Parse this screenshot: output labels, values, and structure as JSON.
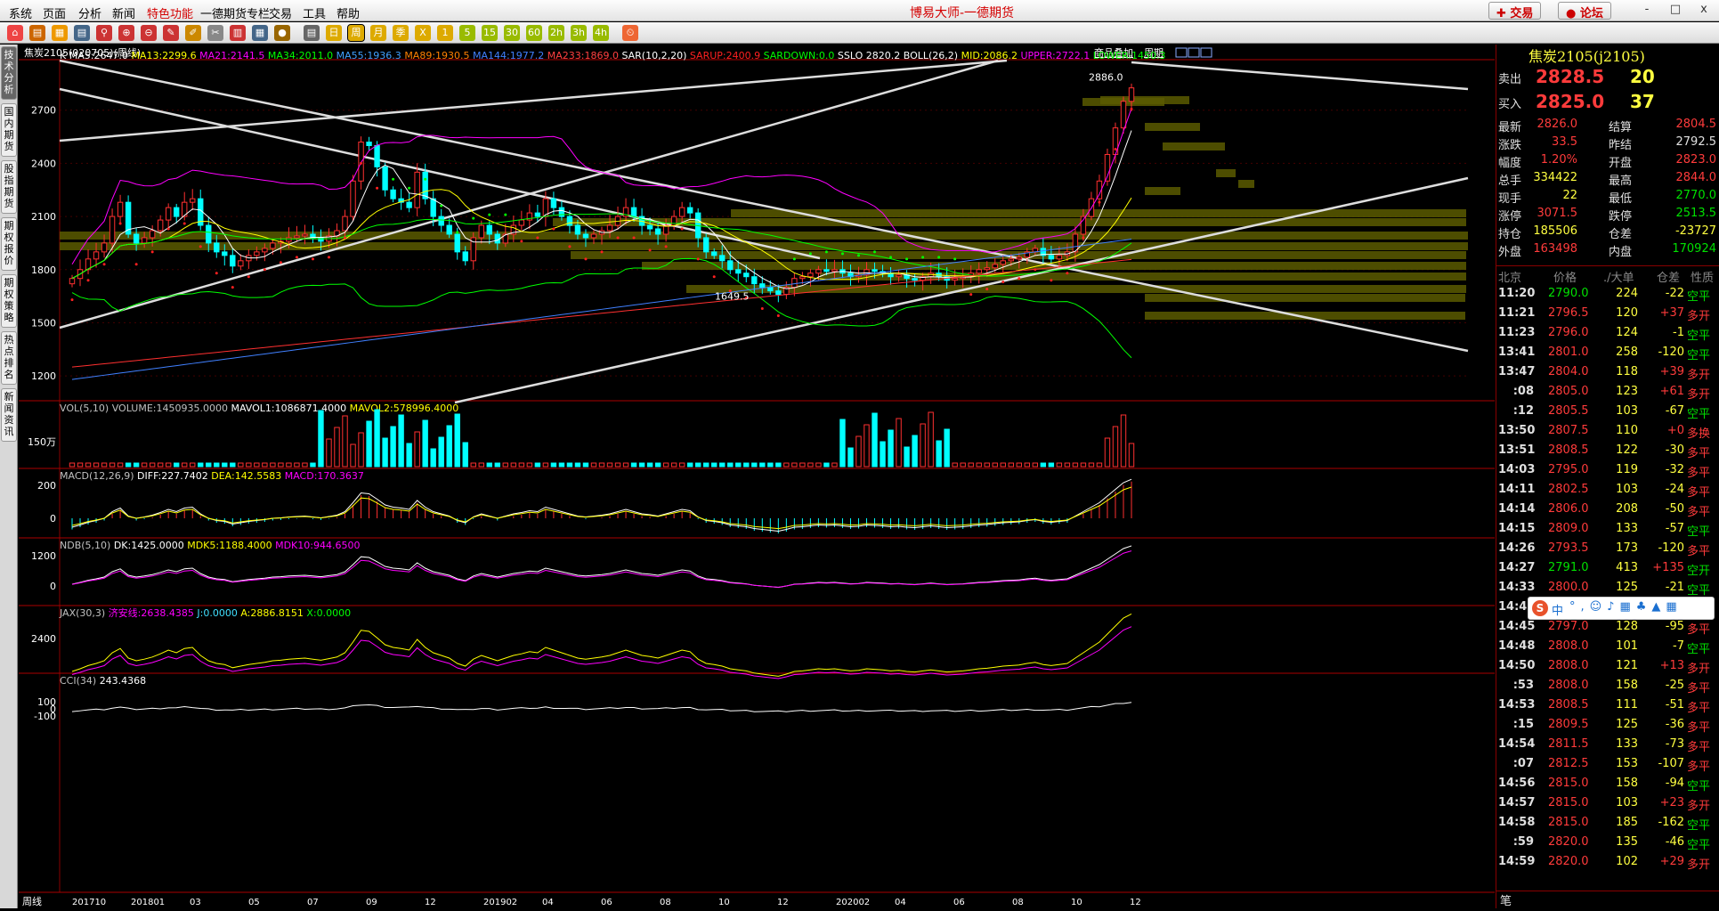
{
  "app_title": "博易大师-一德期货",
  "menu": [
    "系统",
    "页面",
    "分析",
    "新闻",
    "特色功能",
    "一德期货专栏",
    "交易",
    "工具",
    "帮助"
  ],
  "top_buttons": {
    "trade": "交易",
    "forum": "论坛"
  },
  "window_buttons": [
    "-",
    "□",
    "x"
  ],
  "toolbar_icons": [
    "home-icon",
    "folder-icon",
    "open-icon",
    "grid-icon",
    "search-icon",
    "zoom-in-icon",
    "zoom-out-icon",
    "draw-icon",
    "brush-icon",
    "cut-icon",
    "bar-icon",
    "calc-icon",
    "bullet-icon",
    "table-icon",
    "day-icon",
    "week-icon",
    "month-icon",
    "season-icon",
    "x-icon",
    "1-icon",
    "5-icon",
    "15-icon",
    "30-icon",
    "60-icon",
    "2h-icon",
    "3h-icon",
    "4h-icon",
    "clock-icon"
  ],
  "left_tabs": [
    "技术分析",
    "国内期货",
    "股指期货",
    "期权报价",
    "期权策略",
    "热点排名",
    "新闻资讯"
  ],
  "chart": {
    "header": "焦炭2105(020705)(周线)",
    "header_links": [
      "商品叠加",
      "周期"
    ],
    "ma_label": "K",
    "ma_line": [
      {
        "t": "MA5:2647.0",
        "c": "#ffffff"
      },
      {
        "t": "MA13:2299.6",
        "c": "#ffff00"
      },
      {
        "t": "MA21:2141.5",
        "c": "#ff00ff"
      },
      {
        "t": "MA34:2011.0",
        "c": "#00ff00"
      },
      {
        "t": "MA55:1936.3",
        "c": "#40a0ff"
      },
      {
        "t": "MA89:1930.5",
        "c": "#ff8000"
      },
      {
        "t": "MA144:1977.2",
        "c": "#4080ff"
      },
      {
        "t": "MA233:1869.0",
        "c": "#ff4040"
      },
      {
        "t": "SAR(10,2,20)",
        "c": "#ffffff"
      },
      {
        "t": "SARUP:2400.9",
        "c": "#ff2020"
      },
      {
        "t": "SARDOWN:0.0",
        "c": "#00ff00"
      },
      {
        "t": "SSLO 2820.2",
        "c": "#ffffff"
      },
      {
        "t": "BOLL(26,2)",
        "c": "#ffffff"
      },
      {
        "t": "MID:2086.2",
        "c": "#ffff00"
      },
      {
        "t": "UPPER:2722.1",
        "c": "#ff00ff"
      },
      {
        "t": "LOWER:1450.3",
        "c": "#00ff00"
      }
    ],
    "price_axis": [
      "2700",
      "2400",
      "2100",
      "1800",
      "1500",
      "1200"
    ],
    "hi_label": "2886.0",
    "lo_label": "1649.5",
    "vol_line": [
      {
        "t": "VOL(5,10)",
        "c": "#c0c0c0"
      },
      {
        "t": "VOLUME:1450935.0000",
        "c": "#c0c0c0"
      },
      {
        "t": "MAVOL1:1086871.4000",
        "c": "#ffffff"
      },
      {
        "t": "MAVOL2:578996.4000",
        "c": "#ffff00"
      }
    ],
    "vol_axis": [
      "150万"
    ],
    "macd_line": [
      {
        "t": "MACD(12,26,9)",
        "c": "#c0c0c0"
      },
      {
        "t": "DIFF:227.7402",
        "c": "#ffffff"
      },
      {
        "t": "DEA:142.5583",
        "c": "#ffff00"
      },
      {
        "t": "MACD:170.3637",
        "c": "#ff00ff"
      }
    ],
    "macd_axis": [
      "200",
      "0"
    ],
    "ndb_line": [
      {
        "t": "NDB(5,10)",
        "c": "#c0c0c0"
      },
      {
        "t": "DK:1425.0000",
        "c": "#ffffff"
      },
      {
        "t": "MDK5:1188.4000",
        "c": "#ffff00"
      },
      {
        "t": "MDK10:944.6500",
        "c": "#ff00ff"
      }
    ],
    "ndb_axis": [
      "1200",
      "0"
    ],
    "jax_line": [
      {
        "t": "JAX(30,3)",
        "c": "#c0c0c0"
      },
      {
        "t": "济安线:2638.4385",
        "c": "#ff00ff"
      },
      {
        "t": "J:0.0000",
        "c": "#40e0ff"
      },
      {
        "t": "A:2886.8151",
        "c": "#ffff00"
      },
      {
        "t": "X:0.0000",
        "c": "#00ff00"
      }
    ],
    "jax_axis": [
      "2400"
    ],
    "cci_line": [
      {
        "t": "CCI(34)",
        "c": "#c0c0c0"
      },
      {
        "t": "243.4368",
        "c": "#ffffff"
      }
    ],
    "cci_axis": [
      "100",
      "0",
      "-100"
    ],
    "bottom_label": "周线",
    "date_axis": [
      "201710",
      "201801",
      "03",
      "05",
      "07",
      "09",
      "12",
      "201902",
      "04",
      "06",
      "08",
      "10",
      "12",
      "202002",
      "04",
      "06",
      "08",
      "10",
      "12"
    ]
  },
  "chart_data": {
    "type": "candlestick",
    "ylim": [
      1100,
      2950
    ],
    "closes": [
      1750,
      1800,
      1860,
      1900,
      1950,
      2100,
      2180,
      2000,
      1950,
      1980,
      2020,
      2080,
      2150,
      2100,
      2180,
      2200,
      2050,
      1950,
      1900,
      1880,
      1820,
      1850,
      1880,
      1900,
      1920,
      1950,
      1960,
      1980,
      1990,
      2000,
      1980,
      1960,
      1990,
      2020,
      2100,
      2300,
      2520,
      2500,
      2380,
      2250,
      2200,
      2180,
      2150,
      2350,
      2200,
      2100,
      2050,
      2000,
      1900,
      1850,
      1980,
      2050,
      2000,
      1950,
      2000,
      2050,
      2080,
      2120,
      2100,
      2200,
      2150,
      2100,
      2050,
      2000,
      1980,
      2000,
      2020,
      2050,
      2100,
      2150,
      2100,
      2050,
      2030,
      2000,
      2050,
      2100,
      2150,
      2120,
      1980,
      1900,
      1880,
      1850,
      1800,
      1780,
      1760,
      1720,
      1700,
      1680,
      1660,
      1700,
      1750,
      1760,
      1780,
      1800,
      1790,
      1800,
      1780,
      1760,
      1770,
      1800,
      1790,
      1780,
      1760,
      1770,
      1750,
      1740,
      1760,
      1780,
      1760,
      1740,
      1750,
      1760,
      1780,
      1800,
      1810,
      1830,
      1850,
      1860,
      1870,
      1900,
      1920,
      1880,
      1860,
      1880,
      1900,
      2000,
      2100,
      2200,
      2300,
      2450,
      2600,
      2750,
      2826
    ],
    "sar_up": 2400.9,
    "boll_mid": 2086.2,
    "boll_upper": 2722.1,
    "boll_lower": 1450.3
  },
  "quote": {
    "title": "焦炭2105(j2105)",
    "sell": {
      "label": "卖出",
      "price": "2828.5",
      "vol": "20"
    },
    "buy": {
      "label": "买入",
      "price": "2825.0",
      "vol": "37"
    },
    "stats": [
      {
        "l1": "最新",
        "v1": "2826.0",
        "c1": "red",
        "l2": "结算",
        "v2": "2804.5",
        "c2": "red"
      },
      {
        "l1": "涨跌",
        "v1": "33.5",
        "c1": "red",
        "l2": "昨结",
        "v2": "2792.5",
        "c2": "wht"
      },
      {
        "l1": "幅度",
        "v1": "1.20%",
        "c1": "red",
        "l2": "开盘",
        "v2": "2823.0",
        "c2": "red"
      },
      {
        "l1": "总手",
        "v1": "334422",
        "c1": "yel",
        "l2": "最高",
        "v2": "2844.0",
        "c2": "red"
      },
      {
        "l1": "现手",
        "v1": "22",
        "c1": "yel",
        "l2": "最低",
        "v2": "2770.0",
        "c2": "grn"
      },
      {
        "l1": "涨停",
        "v1": "3071.5",
        "c1": "red",
        "l2": "跌停",
        "v2": "2513.5",
        "c2": "grn"
      },
      {
        "l1": "持仓",
        "v1": "185506",
        "c1": "yel",
        "l2": "仓差",
        "v2": "-23727",
        "c2": "yel"
      },
      {
        "l1": "外盘",
        "v1": "163498",
        "c1": "red",
        "l2": "内盘",
        "v2": "170924",
        "c2": "grn"
      }
    ],
    "ticks_header": [
      "北京",
      "价格",
      "./大单",
      "仓差",
      "性质"
    ],
    "ticks": [
      [
        "11:20",
        "2790.0",
        "grn",
        "224",
        "-22",
        "空平"
      ],
      [
        "11:21",
        "2796.5",
        "red",
        "120",
        "+37",
        "多开"
      ],
      [
        "11:23",
        "2796.0",
        "red",
        "124",
        "-1",
        "空平"
      ],
      [
        "13:41",
        "2801.0",
        "red",
        "258",
        "-120",
        "空平"
      ],
      [
        "13:47",
        "2804.0",
        "red",
        "118",
        "+39",
        "多开"
      ],
      [
        ":08",
        "2805.0",
        "red",
        "123",
        "+61",
        "多开"
      ],
      [
        ":12",
        "2805.5",
        "red",
        "103",
        "-67",
        "空平"
      ],
      [
        "13:50",
        "2807.5",
        "red",
        "110",
        "+0",
        "多换"
      ],
      [
        "13:51",
        "2808.5",
        "red",
        "122",
        "-30",
        "多平"
      ],
      [
        "14:03",
        "2795.0",
        "red",
        "119",
        "-32",
        "多平"
      ],
      [
        "14:11",
        "2802.5",
        "red",
        "103",
        "-24",
        "多平"
      ],
      [
        "14:14",
        "2806.0",
        "red",
        "208",
        "-50",
        "多平"
      ],
      [
        "14:15",
        "2809.0",
        "red",
        "133",
        "-57",
        "空平"
      ],
      [
        "14:26",
        "2793.5",
        "red",
        "173",
        "-120",
        "多平"
      ],
      [
        "14:27",
        "2791.0",
        "grn",
        "413",
        "+135",
        "空开"
      ],
      [
        "14:33",
        "2800.0",
        "red",
        "125",
        "-21",
        "空平"
      ],
      [
        "14:40",
        "2800.0",
        "red",
        "",
        "",
        ""
      ],
      [
        "14:45",
        "2797.0",
        "red",
        "128",
        "-95",
        "多平"
      ],
      [
        "14:48",
        "2808.0",
        "red",
        "101",
        "-7",
        "空平"
      ],
      [
        "14:50",
        "2808.0",
        "red",
        "121",
        "+13",
        "多开"
      ],
      [
        ":53",
        "2808.0",
        "red",
        "158",
        "-25",
        "多平"
      ],
      [
        "14:53",
        "2808.5",
        "red",
        "111",
        "-51",
        "多平"
      ],
      [
        ":15",
        "2809.5",
        "red",
        "125",
        "-36",
        "多平"
      ],
      [
        "14:54",
        "2811.5",
        "red",
        "133",
        "-73",
        "多平"
      ],
      [
        ":07",
        "2812.5",
        "red",
        "153",
        "-107",
        "多平"
      ],
      [
        "14:56",
        "2815.0",
        "red",
        "158",
        "-94",
        "空平"
      ],
      [
        "14:57",
        "2815.0",
        "red",
        "103",
        "+23",
        "多开"
      ],
      [
        "14:58",
        "2815.0",
        "red",
        "185",
        "-162",
        "空平"
      ],
      [
        ":59",
        "2820.0",
        "red",
        "135",
        "-46",
        "空平"
      ],
      [
        "14:59",
        "2820.0",
        "red",
        "102",
        "+29",
        "多开"
      ]
    ],
    "footer": "笔"
  },
  "ime": {
    "label": "中"
  }
}
